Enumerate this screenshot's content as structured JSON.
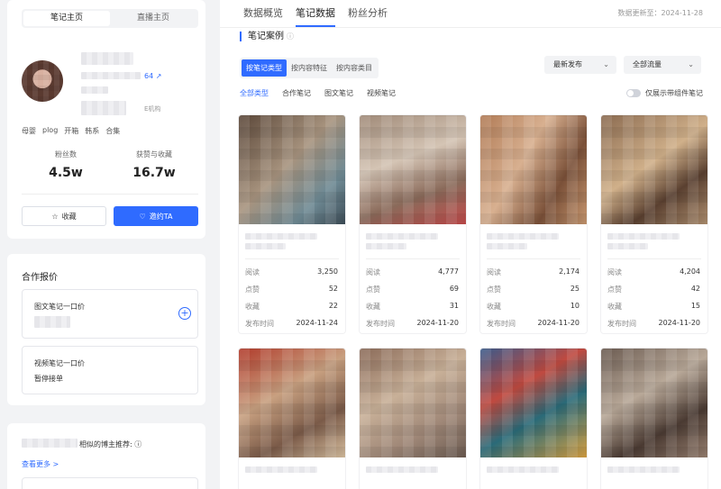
{
  "profile": {
    "tabs": [
      "笔记主页",
      "直播主页"
    ],
    "link_suffix": "64",
    "org_label": "E机构",
    "tags": [
      "母婴",
      "plog",
      "开箱",
      "韩系",
      "合集"
    ],
    "stats": [
      {
        "label": "粉丝数",
        "value": "4.5w"
      },
      {
        "label": "获赞与收藏",
        "value": "16.7w"
      }
    ],
    "fav_label": "收藏",
    "invite_label": "邀约TA"
  },
  "quote": {
    "title": "合作报价",
    "items": [
      {
        "label": "图文笔记一口价",
        "value": ""
      },
      {
        "label": "视频笔记一口价",
        "value": "暂停接单"
      }
    ]
  },
  "recommend": {
    "title_suffix": "相似的博主推荐:",
    "more": "查看更多 >"
  },
  "main": {
    "nav": [
      "数据概览",
      "笔记数据",
      "粉丝分析"
    ],
    "updated": "数据更新至：2024-11-28",
    "section_title": "笔记案例",
    "segments": [
      "按笔记类型",
      "按内容特征",
      "按内容类目"
    ],
    "sort_select": "最新发布",
    "flow_select": "全部流量",
    "filters": [
      "全部类型",
      "合作笔记",
      "图文笔记",
      "视频笔记"
    ],
    "toggle_label": "仅展示带组件笔记",
    "metric_labels": [
      "阅读",
      "点赞",
      "收藏",
      "发布时间"
    ]
  },
  "notes": [
    {
      "reads": "3,250",
      "likes": "52",
      "favorites": "22",
      "date": "2024-11-24"
    },
    {
      "reads": "4,777",
      "likes": "69",
      "favorites": "31",
      "date": "2024-11-20"
    },
    {
      "reads": "2,174",
      "likes": "25",
      "favorites": "10",
      "date": "2024-11-20"
    },
    {
      "reads": "4,204",
      "likes": "42",
      "favorites": "15",
      "date": "2024-11-20"
    }
  ],
  "colors": {
    "accent": "#2f6bff",
    "background": "#f2f3f5"
  }
}
